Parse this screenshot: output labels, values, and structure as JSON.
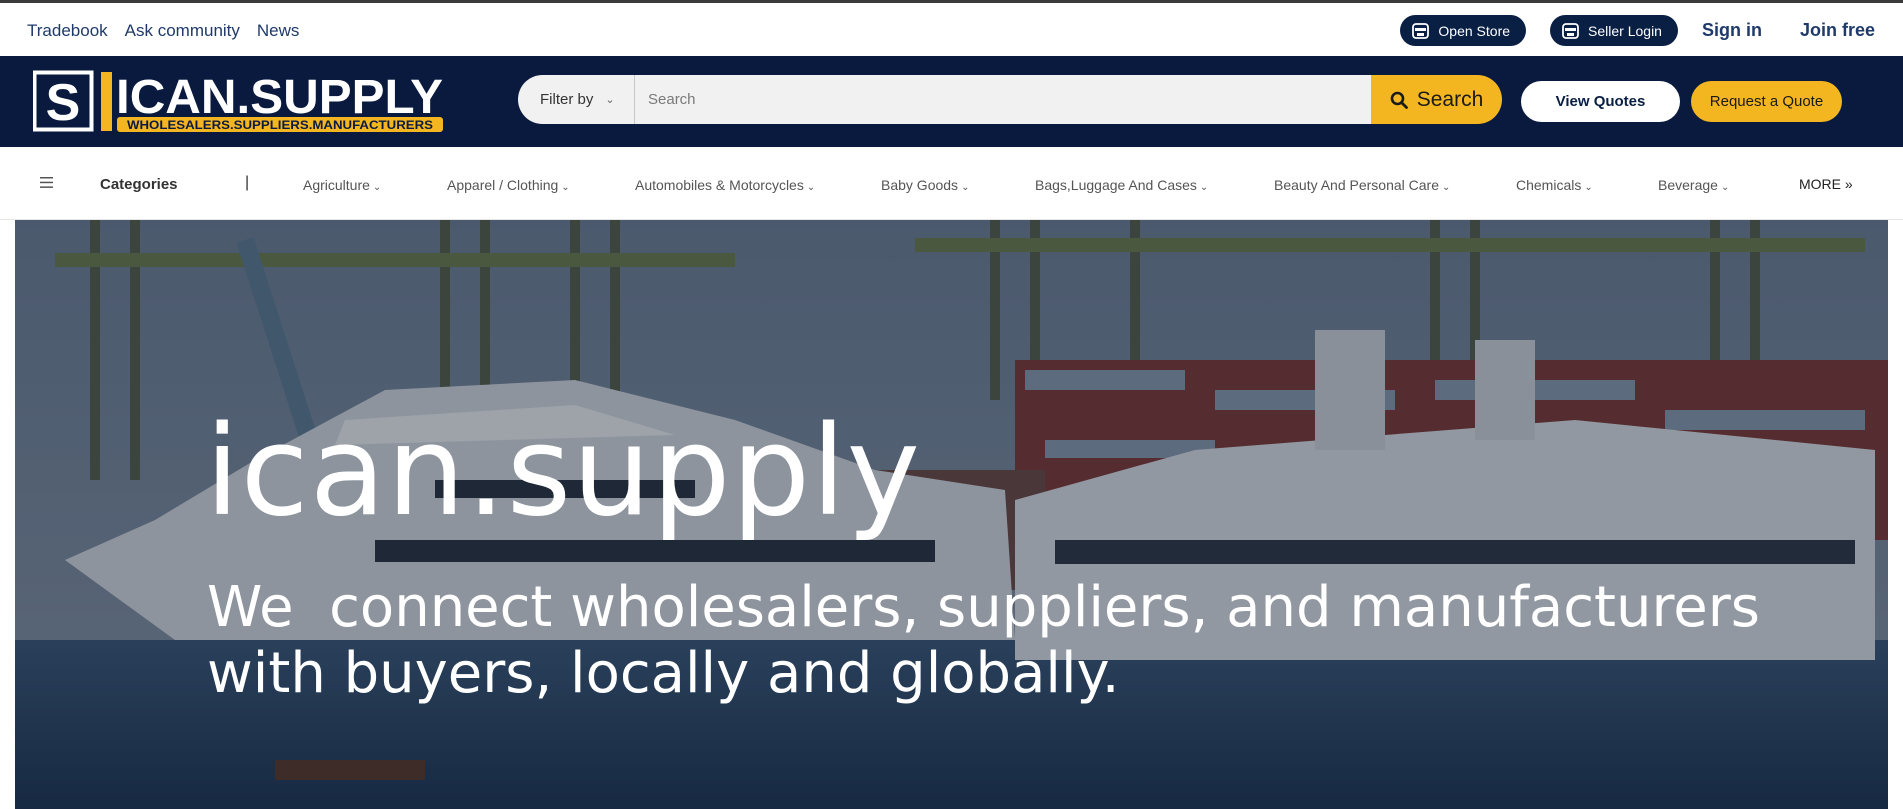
{
  "topbar": {
    "links": [
      "Tradebook",
      "Ask community",
      "News"
    ],
    "open_store": "Open Store",
    "seller_login": "Seller Login",
    "sign_in": "Sign in",
    "join_free": "Join free"
  },
  "logo": {
    "letter": "S",
    "wordmark": "ICAN.SUPPLY",
    "tagline": "WHOLESALERS.SUPPLIERS.MANUFACTURERS"
  },
  "search": {
    "filter_label": "Filter by",
    "placeholder": "Search",
    "button_label": "Search"
  },
  "actions": {
    "view_quotes": "View Quotes",
    "request_quote": "Request a Quote"
  },
  "categories": {
    "title": "Categories",
    "separator": "|",
    "items": [
      "Agriculture",
      "Apparel / Clothing",
      "Automobiles & Motorcycles",
      "Baby Goods",
      "Bags,Luggage And Cases",
      "Beauty And Personal Care",
      "Chemicals",
      "Beverage"
    ],
    "more": "MORE »"
  },
  "hero": {
    "title": "ican.supply",
    "subtitle": "We  connect wholesalers, suppliers, and manufacturers with buyers, locally and globally."
  },
  "colors": {
    "navy": "#0a1a3f",
    "yellow": "#f4b620",
    "link_blue": "#1f3a6a"
  }
}
